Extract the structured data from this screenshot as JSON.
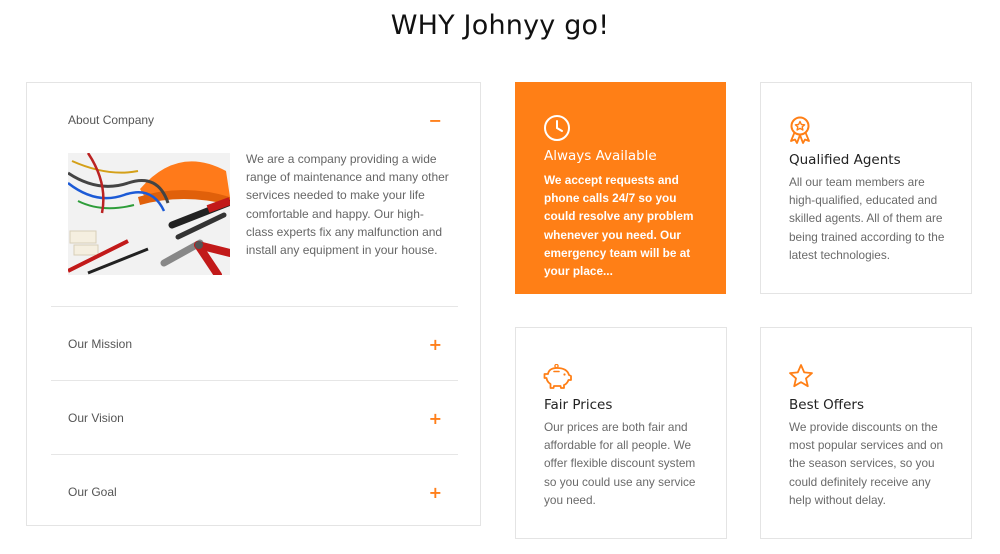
{
  "heading": "WHY Johnyy go!",
  "accordion": {
    "items": [
      {
        "label": "About Company",
        "toggle": "−",
        "expanded": true,
        "body": "We are a company providing a wide range of maintenance and many other services needed to make your life comfortable and happy. Our high-class experts fix any malfunction and install any equipment in your house."
      },
      {
        "label": "Our Mission",
        "toggle": "+",
        "expanded": false
      },
      {
        "label": "Our Vision",
        "toggle": "+",
        "expanded": false
      },
      {
        "label": "Our Goal",
        "toggle": "+",
        "expanded": false
      }
    ]
  },
  "features": [
    {
      "icon": "clock-icon",
      "title": "Always Available",
      "text": "We accept requests and phone calls 24/7 so you could resolve any problem whenever you need. Our emergency team will be at your place..."
    },
    {
      "icon": "award-ribbon-icon",
      "title": "Qualified Agents",
      "text": "All our team members are high-qualified, educated and skilled agents. All of them are being trained according to the latest technologies."
    },
    {
      "icon": "piggy-bank-icon",
      "title": "Fair Prices",
      "text": "Our prices are both fair and affordable for all people. We offer flexible discount system so you could use any service you need."
    },
    {
      "icon": "star-icon",
      "title": "Best Offers",
      "text": "We provide discounts on the most popular services and on the season services, so you could definitely receive any help without delay."
    }
  ],
  "colors": {
    "accent": "#ff7f16",
    "text_muted": "#666666",
    "border": "#e4e4e4"
  }
}
